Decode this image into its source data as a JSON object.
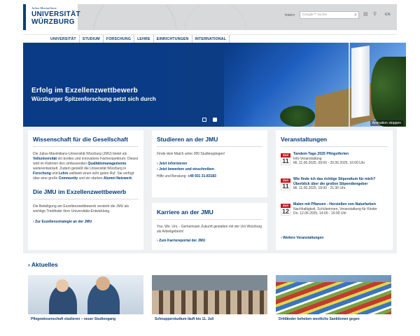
{
  "header": {
    "logo_line1": "Julius-Maximilians-",
    "logo_line2": "UNIVERSITÄT",
    "logo_line3": "WÜRZBURG",
    "intern_label": "Intern",
    "search_placeholder": "Google™ Suche",
    "lang": "EN",
    "icons": [
      "search-icon",
      "print-icon",
      "sitemap-icon"
    ]
  },
  "nav": [
    "UNIVERSITÄT",
    "STUDIUM",
    "FORSCHUNG",
    "LEHRE",
    "EINRICHTUNGEN",
    "INTERNATIONAL"
  ],
  "hero": {
    "title": "Erfolg im Exzellenzwettbewerb",
    "subtitle": "Würzburger Spitzenforschung setzt sich durch",
    "anim_label": "Animation stoppen"
  },
  "col1": {
    "title1": "Wissenschaft für die Gesellschaft",
    "text1_a": "Die Julius-Maximilians-Universität Würzburg (JMU) bietet als ",
    "text1_b": "Volluniversität",
    "text1_c": " ein breites und innovatives Fächerspektrum. Dieses wird im Rahmen des umfassenden ",
    "text1_d": "Qualitätsmanagements",
    "text1_e": " weiterentwickelt. Zudem genießt die Universität Würzburg in ",
    "text1_f": "Forschung",
    "text1_g": " und ",
    "text1_h": "Lehre",
    "text1_i": " weltweit einen sehr guten Ruf. Sie verfügt über eine große ",
    "text1_j": "Community",
    "text1_k": " und ein starkes ",
    "text1_l": "Alumni Netzwerk",
    "text1_m": ".",
    "title2": "Die JMU im Exzellenzwettbewerb",
    "text2": "Die Beteiligung am Exzellenzwettbewerb versteht die JMU als wichtige Triebfeder ihrer Universitäts-Entwicklung.",
    "link": "Zur Exzellenzstrategie an der JMU"
  },
  "col2": {
    "title": "Studieren an der JMU",
    "text": "Finde dein Match unter 280 Studiengängen!",
    "link1": "Jetzt informieren",
    "link2": "Jetzt bewerben und einschreiben",
    "hotline_label": "Hilfe und Beratung: ",
    "hotline": "+49 931 31-83183",
    "title2": "Karriere an der JMU",
    "text2": "You. We. Uni. - Gemeinsam Zukunft gestalten mit der Uni Würzburg als Arbeitgeberin!",
    "link3": "Zum Karriereportal der JMU"
  },
  "col3": {
    "title": "Veranstaltungen",
    "events": [
      {
        "mon": "Jun",
        "day": "11",
        "title": "Tandem-Tage 2025 Pfingstferien",
        "sub1": "Info-Veranstaltung",
        "sub2": "Mi, 11.06.2025, 09:00 - 20.06.2025, 16:00 Uhr"
      },
      {
        "mon": "Jun",
        "day": "11",
        "title": "Wie finde ich das richtige Stipendium für mich? Überblick über die großen Stipendiengeber",
        "sub1": "",
        "sub2": "Mi, 11.06.2025, 19:00 - 21:30 Uhr"
      },
      {
        "mon": "Jun",
        "day": "12",
        "title": "Malen mit Pflanzen - Herstellen von Naturfarben",
        "sub1": "Nachhaltigkeit, Schülerinnen, Veranstaltung für Kinder",
        "sub2": "Do, 12.06.2025, 14:00 - 16:00 Uhr"
      }
    ],
    "link": "Weitere Veranstaltungen"
  },
  "aktuelle": "Aktuelles",
  "news": [
    {
      "caption": "Pflegewissenschaft studieren – neuer Studiengang"
    },
    {
      "caption": "Schnupperstudium läuft bis 11. Juli"
    },
    {
      "caption": "Drittländer beheben westliche Sanktionen gegen"
    }
  ]
}
